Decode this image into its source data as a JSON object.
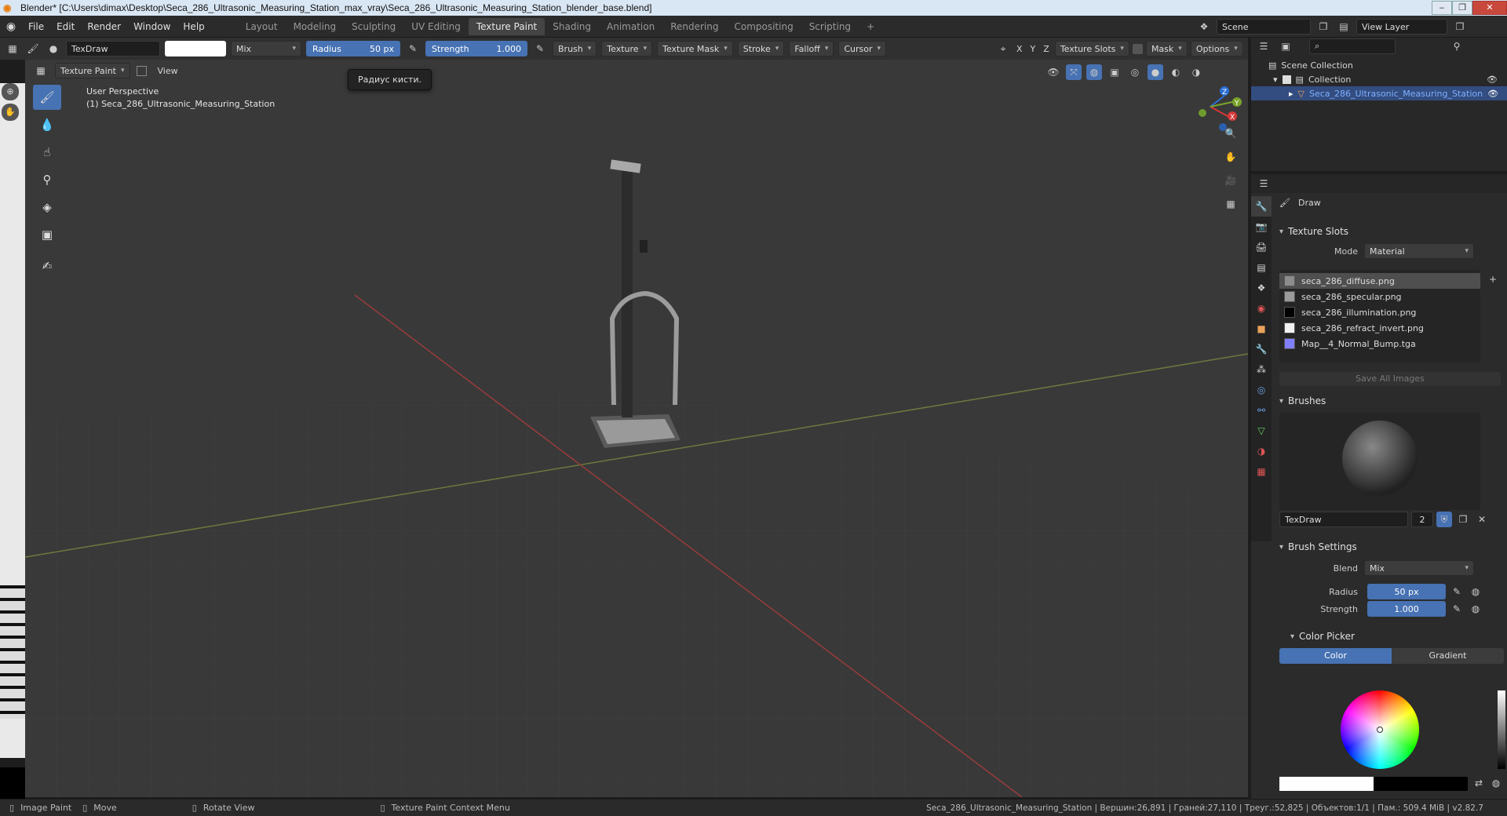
{
  "titlebar": {
    "title": "Blender* [C:\\Users\\dimax\\Desktop\\Seca_286_Ultrasonic_Measuring_Station_max_vray\\Seca_286_Ultrasonic_Measuring_Station_blender_base.blend]"
  },
  "menu": [
    "File",
    "Edit",
    "Render",
    "Window",
    "Help"
  ],
  "workspaces": [
    "Layout",
    "Modeling",
    "Sculpting",
    "UV Editing",
    "Texture Paint",
    "Shading",
    "Animation",
    "Rendering",
    "Compositing",
    "Scripting"
  ],
  "active_workspace": "Texture Paint",
  "scene": {
    "name": "Scene",
    "view_layer": "View Layer"
  },
  "toolheader": {
    "brush_name": "TexDraw",
    "blend": "Mix",
    "radius_label": "Radius",
    "radius_value": "50 px",
    "strength_label": "Strength",
    "strength_value": "1.000",
    "menus": [
      "Brush",
      "Texture",
      "Texture Mask",
      "Stroke",
      "Falloff",
      "Cursor"
    ],
    "axes": [
      "X",
      "Y",
      "Z"
    ],
    "texture_slots": "Texture Slots",
    "mask": "Mask",
    "options": "Options"
  },
  "viewport": {
    "mode": "Texture Paint",
    "view_menu": "View",
    "tooltip": "Радиус кисти.",
    "perspective": "User Perspective",
    "object_label": "(1) Seca_286_Ultrasonic_Measuring_Station"
  },
  "outliner": {
    "scene_collection": "Scene Collection",
    "collection": "Collection",
    "object": "Seca_286_Ultrasonic_Measuring_Station"
  },
  "properties": {
    "tool_name": "Draw",
    "texture_slots": {
      "title": "Texture Slots",
      "mode_label": "Mode",
      "mode_value": "Material",
      "items": [
        {
          "name": "seca_286_diffuse.png",
          "color": "#8c8c8c"
        },
        {
          "name": "seca_286_specular.png",
          "color": "#9a9a9a"
        },
        {
          "name": "seca_286_illumination.png",
          "color": "#000000"
        },
        {
          "name": "seca_286_refract_invert.png",
          "color": "#f2f2f2"
        },
        {
          "name": "Map__4_Normal_Bump.tga",
          "color": "#8080ff"
        }
      ],
      "save_all": "Save All Images"
    },
    "brushes": {
      "title": "Brushes",
      "name": "TexDraw",
      "users": "2"
    },
    "brush_settings": {
      "title": "Brush Settings",
      "blend_label": "Blend",
      "blend_value": "Mix",
      "radius_label": "Radius",
      "radius_value": "50 px",
      "strength_label": "Strength",
      "strength_value": "1.000"
    },
    "color_picker": {
      "title": "Color Picker",
      "tab_color": "Color",
      "tab_gradient": "Gradient"
    }
  },
  "status": {
    "image_paint": "Image Paint",
    "move": "Move",
    "rotate": "Rotate View",
    "context": "Texture Paint Context Menu",
    "stats": "Seca_286_Ultrasonic_Measuring_Station | Вершин:26,891 | Граней:27,110 | Треуг.:52,825 | Объектов:1/1 | Пам.: 509.4 MiB | v2.82.7"
  },
  "colors": {
    "accent": "#4772b3",
    "active_tab": "#444444",
    "selection": "#4f4f4f"
  }
}
